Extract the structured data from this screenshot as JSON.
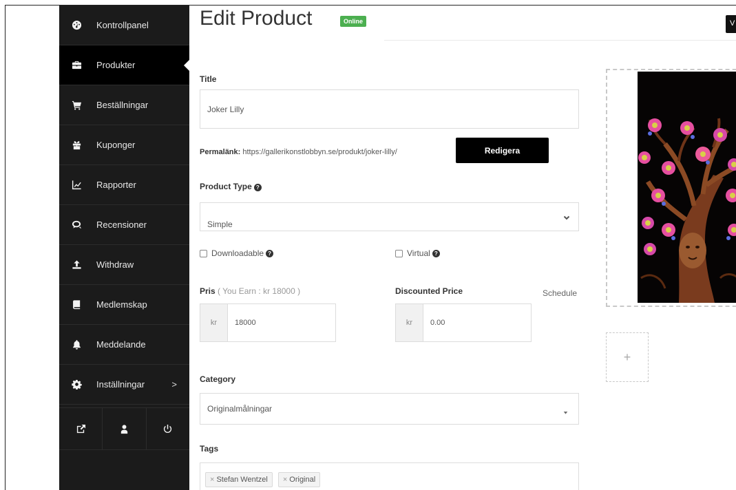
{
  "sidebar": {
    "items": [
      {
        "label": "Kontrollpanel",
        "icon": "dashboard-icon"
      },
      {
        "label": "Produkter",
        "icon": "briefcase-icon"
      },
      {
        "label": "Beställningar",
        "icon": "cart-icon"
      },
      {
        "label": "Kuponger",
        "icon": "gift-icon"
      },
      {
        "label": "Rapporter",
        "icon": "chart-icon"
      },
      {
        "label": "Recensioner",
        "icon": "comments-icon"
      },
      {
        "label": "Withdraw",
        "icon": "upload-icon"
      },
      {
        "label": "Medlemskap",
        "icon": "book-icon"
      },
      {
        "label": "Meddelande",
        "icon": "bell-icon"
      },
      {
        "label": "Inställningar",
        "icon": "gear-icon",
        "chevron": ">"
      }
    ],
    "bottom_icons": [
      "external-link-icon",
      "user-icon",
      "power-icon"
    ]
  },
  "header": {
    "title": "Edit Product",
    "status": "Online",
    "view_button": "V"
  },
  "form": {
    "title_label": "Title",
    "title_value": "Joker Lilly",
    "permalink_label": "Permalänk:",
    "permalink_url": "https://gallerikonstlobbyn.se/produkt/joker-lilly/",
    "edit_button": "Redigera",
    "product_type_label": "Product Type",
    "product_type_value": "Simple",
    "downloadable_label": "Downloadable",
    "virtual_label": "Virtual",
    "price_label": "Pris",
    "price_earn": "( You Earn : kr 18000 )",
    "price_currency": "kr",
    "price_value": "18000",
    "discount_label": "Discounted Price",
    "schedule_label": "Schedule",
    "discount_currency": "kr",
    "discount_value": "0.00",
    "category_label": "Category",
    "category_value": "Originalmålningar",
    "tags_label": "Tags",
    "tags": [
      "Stefan Wentzel",
      "Original"
    ],
    "tag_remove": "×",
    "add_image": "+"
  },
  "colors": {
    "sidebar_bg": "#1b1b1b",
    "sidebar_active": "#000000",
    "status_badge": "#4caf50",
    "button_black": "#000000"
  }
}
